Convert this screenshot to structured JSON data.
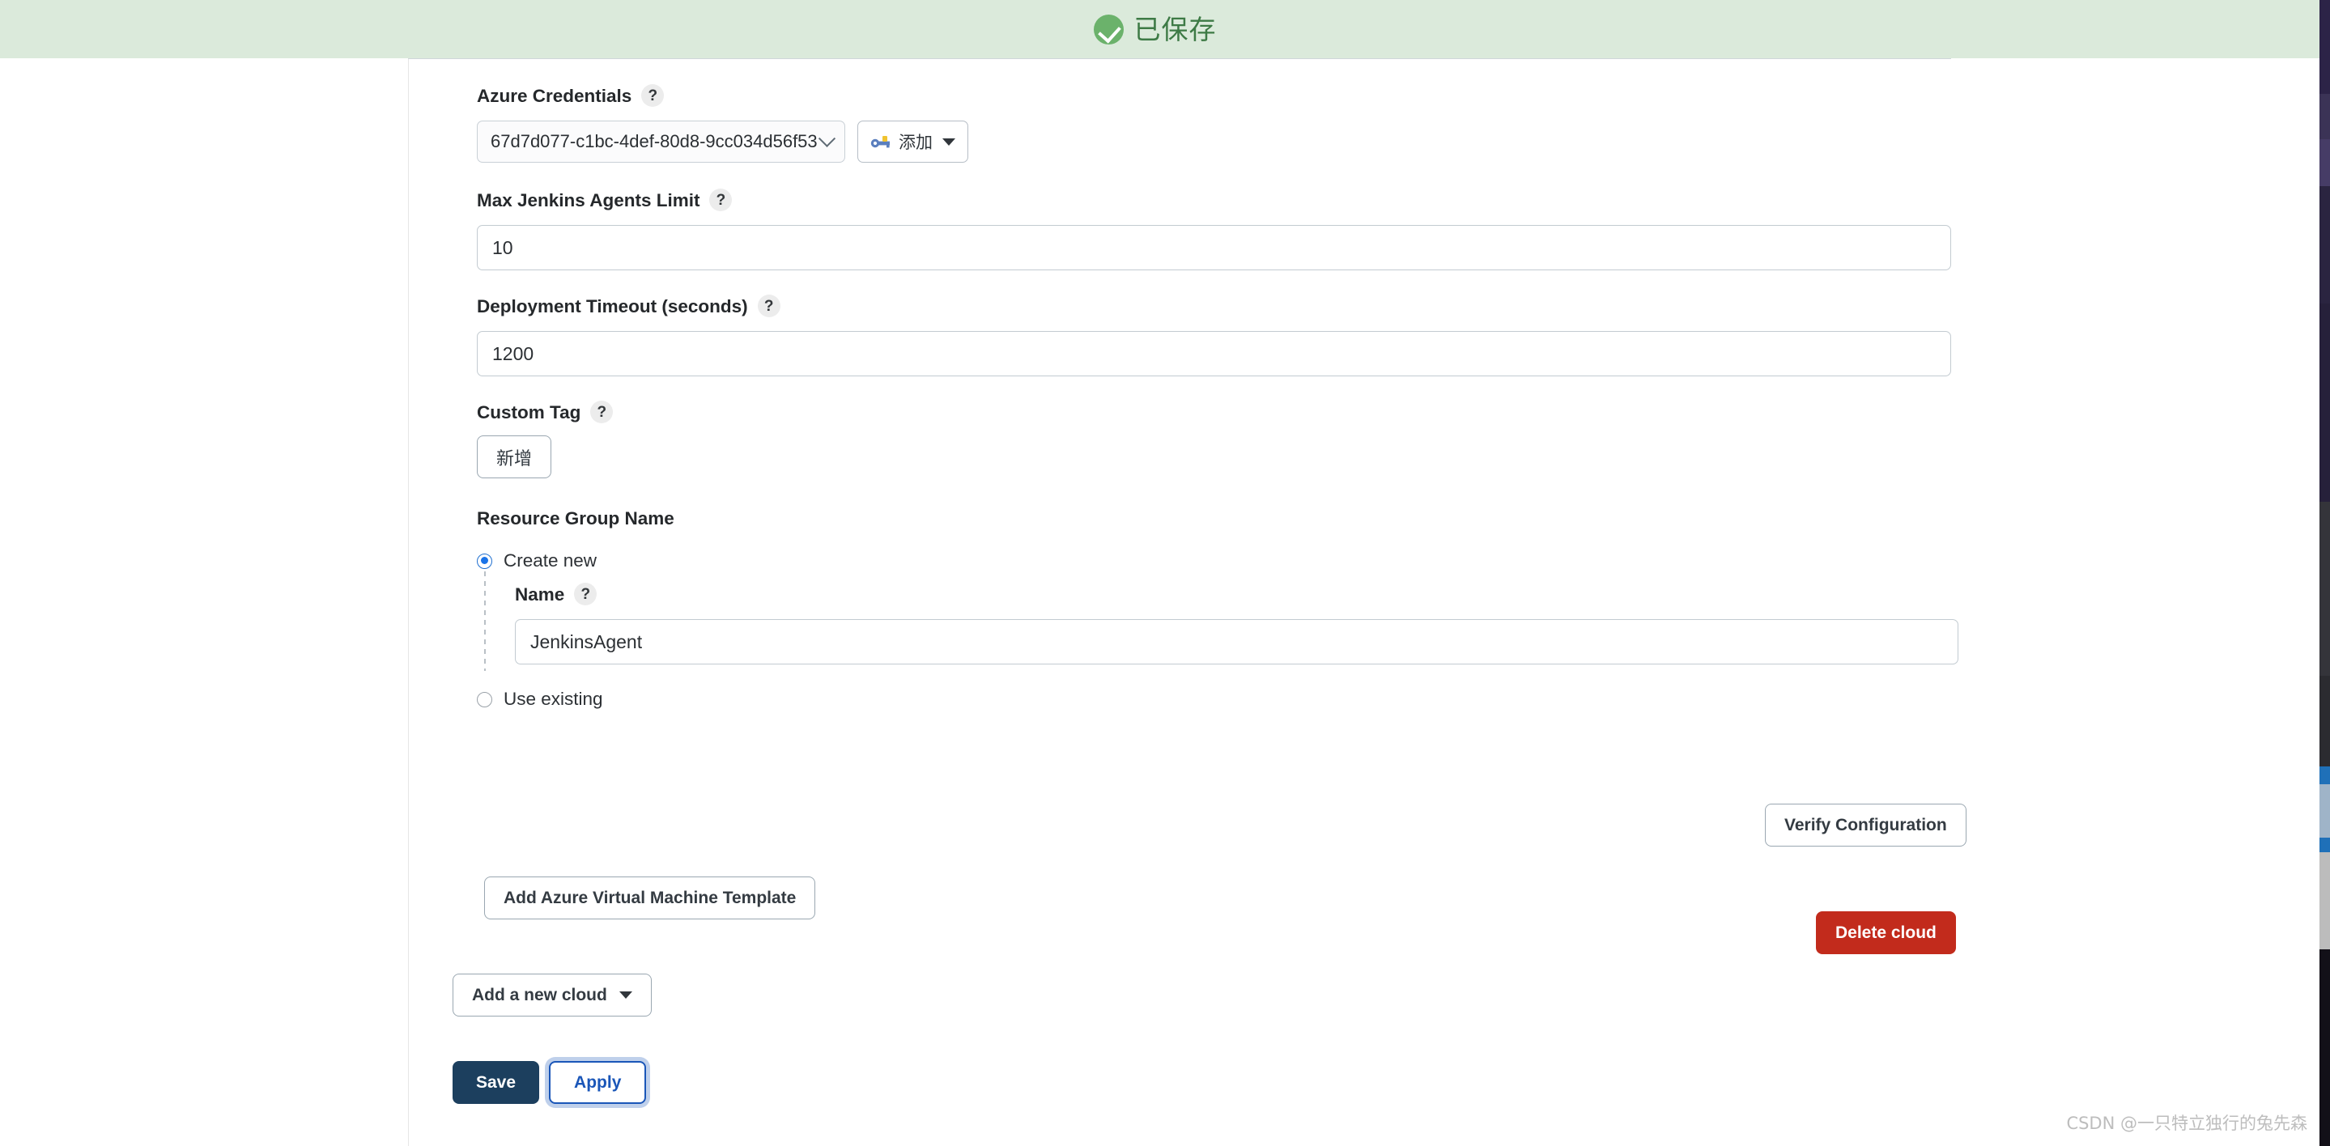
{
  "banner": {
    "text": "已保存",
    "icon": "check-circle-icon",
    "bg_color": "#dbeadb",
    "text_color": "#3d7a45"
  },
  "form": {
    "credentials": {
      "label": "Azure Credentials",
      "help": "?",
      "selected_value": "67d7d077-c1bc-4def-80d8-9cc034d56f53",
      "add_button_label": "添加",
      "add_button_icon": "key-icon"
    },
    "max_agents": {
      "label": "Max Jenkins Agents Limit",
      "help": "?",
      "value": "10"
    },
    "deployment_timeout": {
      "label": "Deployment Timeout (seconds)",
      "help": "?",
      "value": "1200"
    },
    "custom_tag": {
      "label": "Custom Tag",
      "help": "?",
      "add_button_label": "新增"
    },
    "resource_group": {
      "label": "Resource Group Name",
      "options": [
        {
          "label": "Create new",
          "selected": true
        },
        {
          "label": "Use existing",
          "selected": false
        }
      ],
      "name_field": {
        "label": "Name",
        "help": "?",
        "value": "JenkinsAgent"
      }
    }
  },
  "actions": {
    "verify_configuration": "Verify Configuration",
    "add_template": "Add Azure Virtual Machine Template",
    "delete_cloud": "Delete cloud",
    "add_new_cloud": "Add a new cloud",
    "save": "Save",
    "apply": "Apply"
  },
  "colors": {
    "delete": "#c22b1c",
    "save": "#1c3f5e",
    "apply": "#1a56b8",
    "banner": "#dbeadb"
  },
  "watermark": "CSDN @一只特立独行的兔先森"
}
